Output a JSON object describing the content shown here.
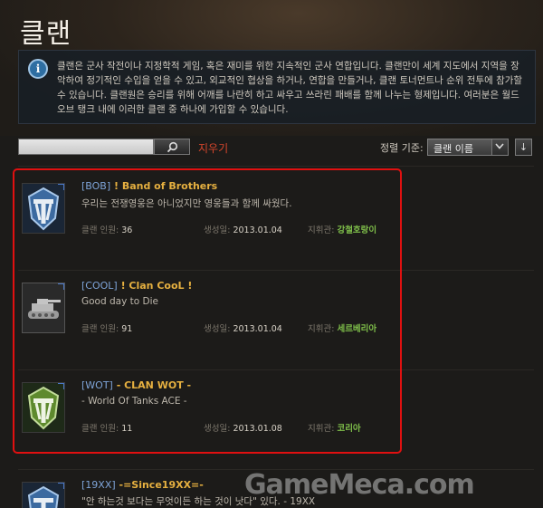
{
  "page": {
    "title": "클랜",
    "info_text": "클랜은 군사 작전이나 지정학적 게임, 혹은 재미를 위한 지속적인 군사 연합입니다. 클랜만이 세계 지도에서 지역을 장악하여 정기적인 수입을 얻을 수 있고, 외교적인 협상을 하거나, 연합을 만들거나, 클랜 토너먼트나 순위 전투에 참가할 수 있습니다. 클랜원은 승리를 위해 어깨를 나란히 하고 싸우고 쓰라린 패배를 함께 나누는 형제입니다. 여러분은 월드 오브 탱크 내에 이러한 클랜 중 하나에 가입할 수 있습니다."
  },
  "search": {
    "placeholder": "",
    "clear_label": "지우기"
  },
  "sort": {
    "label": "정렬 기준:",
    "selected": "클랜 이름",
    "direction_icon": "↓"
  },
  "labels": {
    "members": "클랜 인원:",
    "created": "생성일:",
    "commander": "지휘관:"
  },
  "clans": [
    {
      "tag": "[BOB]",
      "name": "! Band of Brothers",
      "motto": "우리는 전쟁영웅은 아니었지만 영웅들과 함께 싸웠다.",
      "members": "36",
      "created": "2013.01.04",
      "commander": "강철호랑이",
      "emblem": "wot-logo-blue-icon"
    },
    {
      "tag": "[COOL]",
      "name": "! Clan CooL !",
      "motto": "Good day to Die",
      "members": "91",
      "created": "2013.01.04",
      "commander": "세르베리아",
      "emblem": "tank-icon"
    },
    {
      "tag": "[WOT]",
      "name": "- CLAN WOT -",
      "motto": "- World Of Tanks ACE -",
      "members": "11",
      "created": "2013.01.08",
      "commander": "코리아",
      "emblem": "wot-logo-green-icon"
    },
    {
      "tag": "[19XX]",
      "name": "-=Since19XX=-",
      "motto": "\"안 하는것 보다는 무엇이든 하는 것이 낫다\" 있다. - 19XX",
      "emblem": "wot-logo-blue-icon"
    }
  ],
  "watermark": "GameMeca.com",
  "colors": {
    "highlight": "#e01010",
    "clan_name": "#e6b040",
    "clan_tag": "#7ea4d8",
    "commander": "#7fbf4a",
    "clear_link": "#d5462c"
  }
}
